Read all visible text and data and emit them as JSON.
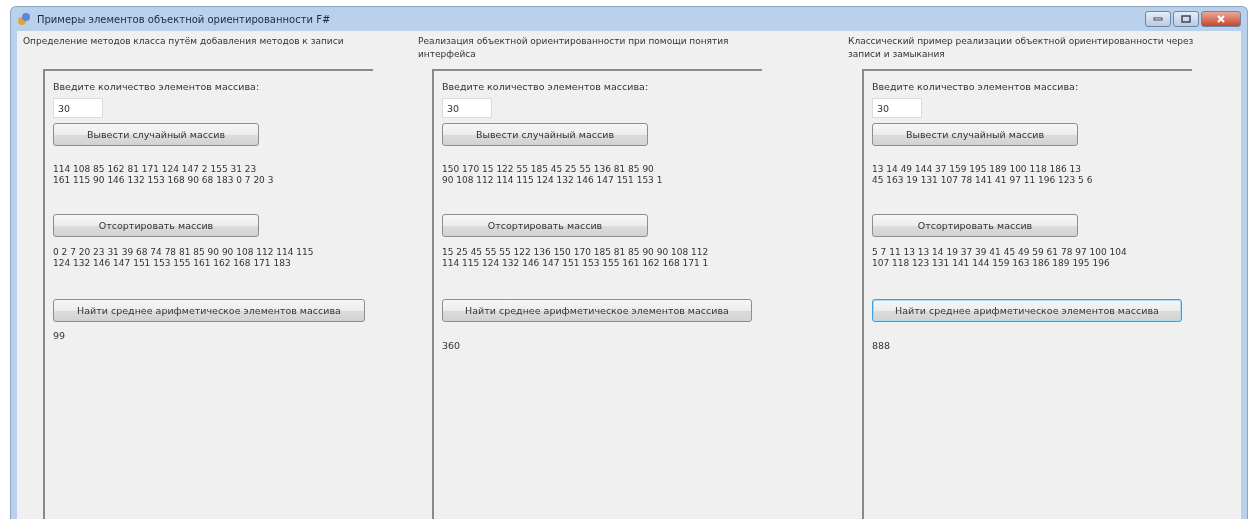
{
  "window": {
    "title": "Примеры элементов объектной ориентированности F#"
  },
  "panels": [
    {
      "heading": "Определение методов класса путём добавления методов к записи",
      "prompt": "Введите количество элементов массива:",
      "count": "30",
      "generate_button": "Вывести случайный массив",
      "random_array": "114 108 85 162 81 171 124 147 2 155 31 23\n161 115 90 146 132 153 168 90 68 183 0 7 20 3",
      "sort_button": "Отсортировать массив",
      "sorted_array": "0 2 7 20 23 31 39 68 74 78 81 85 90 90 108 112 114 115\n124 132 146 147 151 153 155 161 162 168 171 183",
      "average_button": "Найти среднее арифметическое элементов массива",
      "average_focused": false,
      "average": "99"
    },
    {
      "heading": "Реализация объектной ориентированности при помощи понятия интерфейса",
      "prompt": "Введите количество элементов массива:",
      "count": "30",
      "generate_button": "Вывести случайный массив",
      "random_array": "150 170 15 122 55 185 45 25 55 136 81 85 90\n90 108 112 114 115 124 132 146 147 151 153 1",
      "sort_button": "Отсортировать массив",
      "sorted_array": "15 25 45 55 55 122 136 150 170 185 81 85 90 90 108 112\n114 115 124 132 146 147 151 153 155 161 162 168 171 1",
      "average_button": "Найти среднее арифметическое элементов массива",
      "average_focused": false,
      "average": "360"
    },
    {
      "heading": "Классический пример реализации объектной ориентированности через записи и замыкания",
      "prompt": "Введите количество элементов массива:",
      "count": "30",
      "generate_button": "Вывести случайный массив",
      "random_array": "13 14 49 144 37 159 195 189 100 118 186 13\n45 163 19 131 107 78 141 41 97 11 196 123 5 6",
      "sort_button": "Отсортировать массив",
      "sorted_array": "5 7 11 13 13 14 19 37 39 41 45 49 59 61 78 97 100 104\n107 118 123 131 141 144 159 163 186 189 195 196",
      "average_button": "Найти среднее арифметическое элементов массива",
      "average_focused": true,
      "average": "888"
    }
  ]
}
